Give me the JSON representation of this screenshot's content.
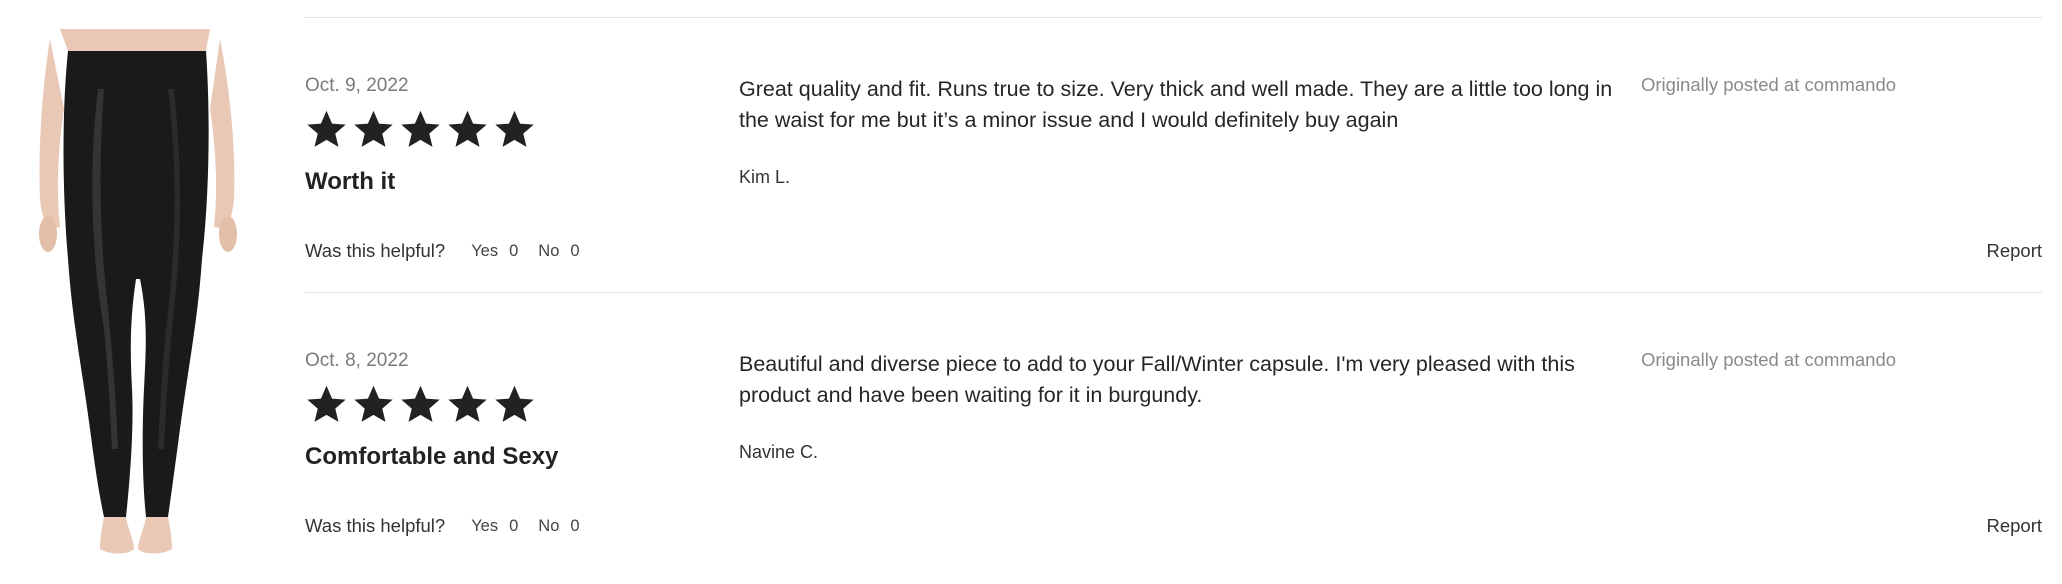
{
  "product": {
    "image_alt": "black faux leather leggings"
  },
  "reviews": [
    {
      "date": "Oct. 9, 2022",
      "rating": 5,
      "headline": "Worth it",
      "body": "Great quality and fit. Runs true to size. Very thick and well made. They are a little too long in the waist for me but it’s a minor issue and I would definitely buy again",
      "author": "Kim L.",
      "origin": "Originally posted at commando",
      "helpful_label": "Was this helpful?",
      "yes_label": "Yes",
      "yes_count": "0",
      "no_label": "No",
      "no_count": "0",
      "report_label": "Report"
    },
    {
      "date": "Oct. 8, 2022",
      "rating": 5,
      "headline": "Comfortable and Sexy",
      "body": "Beautiful and diverse piece to add to your Fall/Winter capsule. I'm very pleased with this product and have been waiting for it in burgundy.",
      "author": "Navine C.",
      "origin": "Originally posted at commando",
      "helpful_label": "Was this helpful?",
      "yes_label": "Yes",
      "yes_count": "0",
      "no_label": "No",
      "no_count": "0",
      "report_label": "Report"
    }
  ],
  "colors": {
    "star": "#222222",
    "divider": "#e3e3e3",
    "muted_text": "#7a7a7a",
    "legging": "#1a1a1a",
    "skin": "#e9c9b6"
  }
}
